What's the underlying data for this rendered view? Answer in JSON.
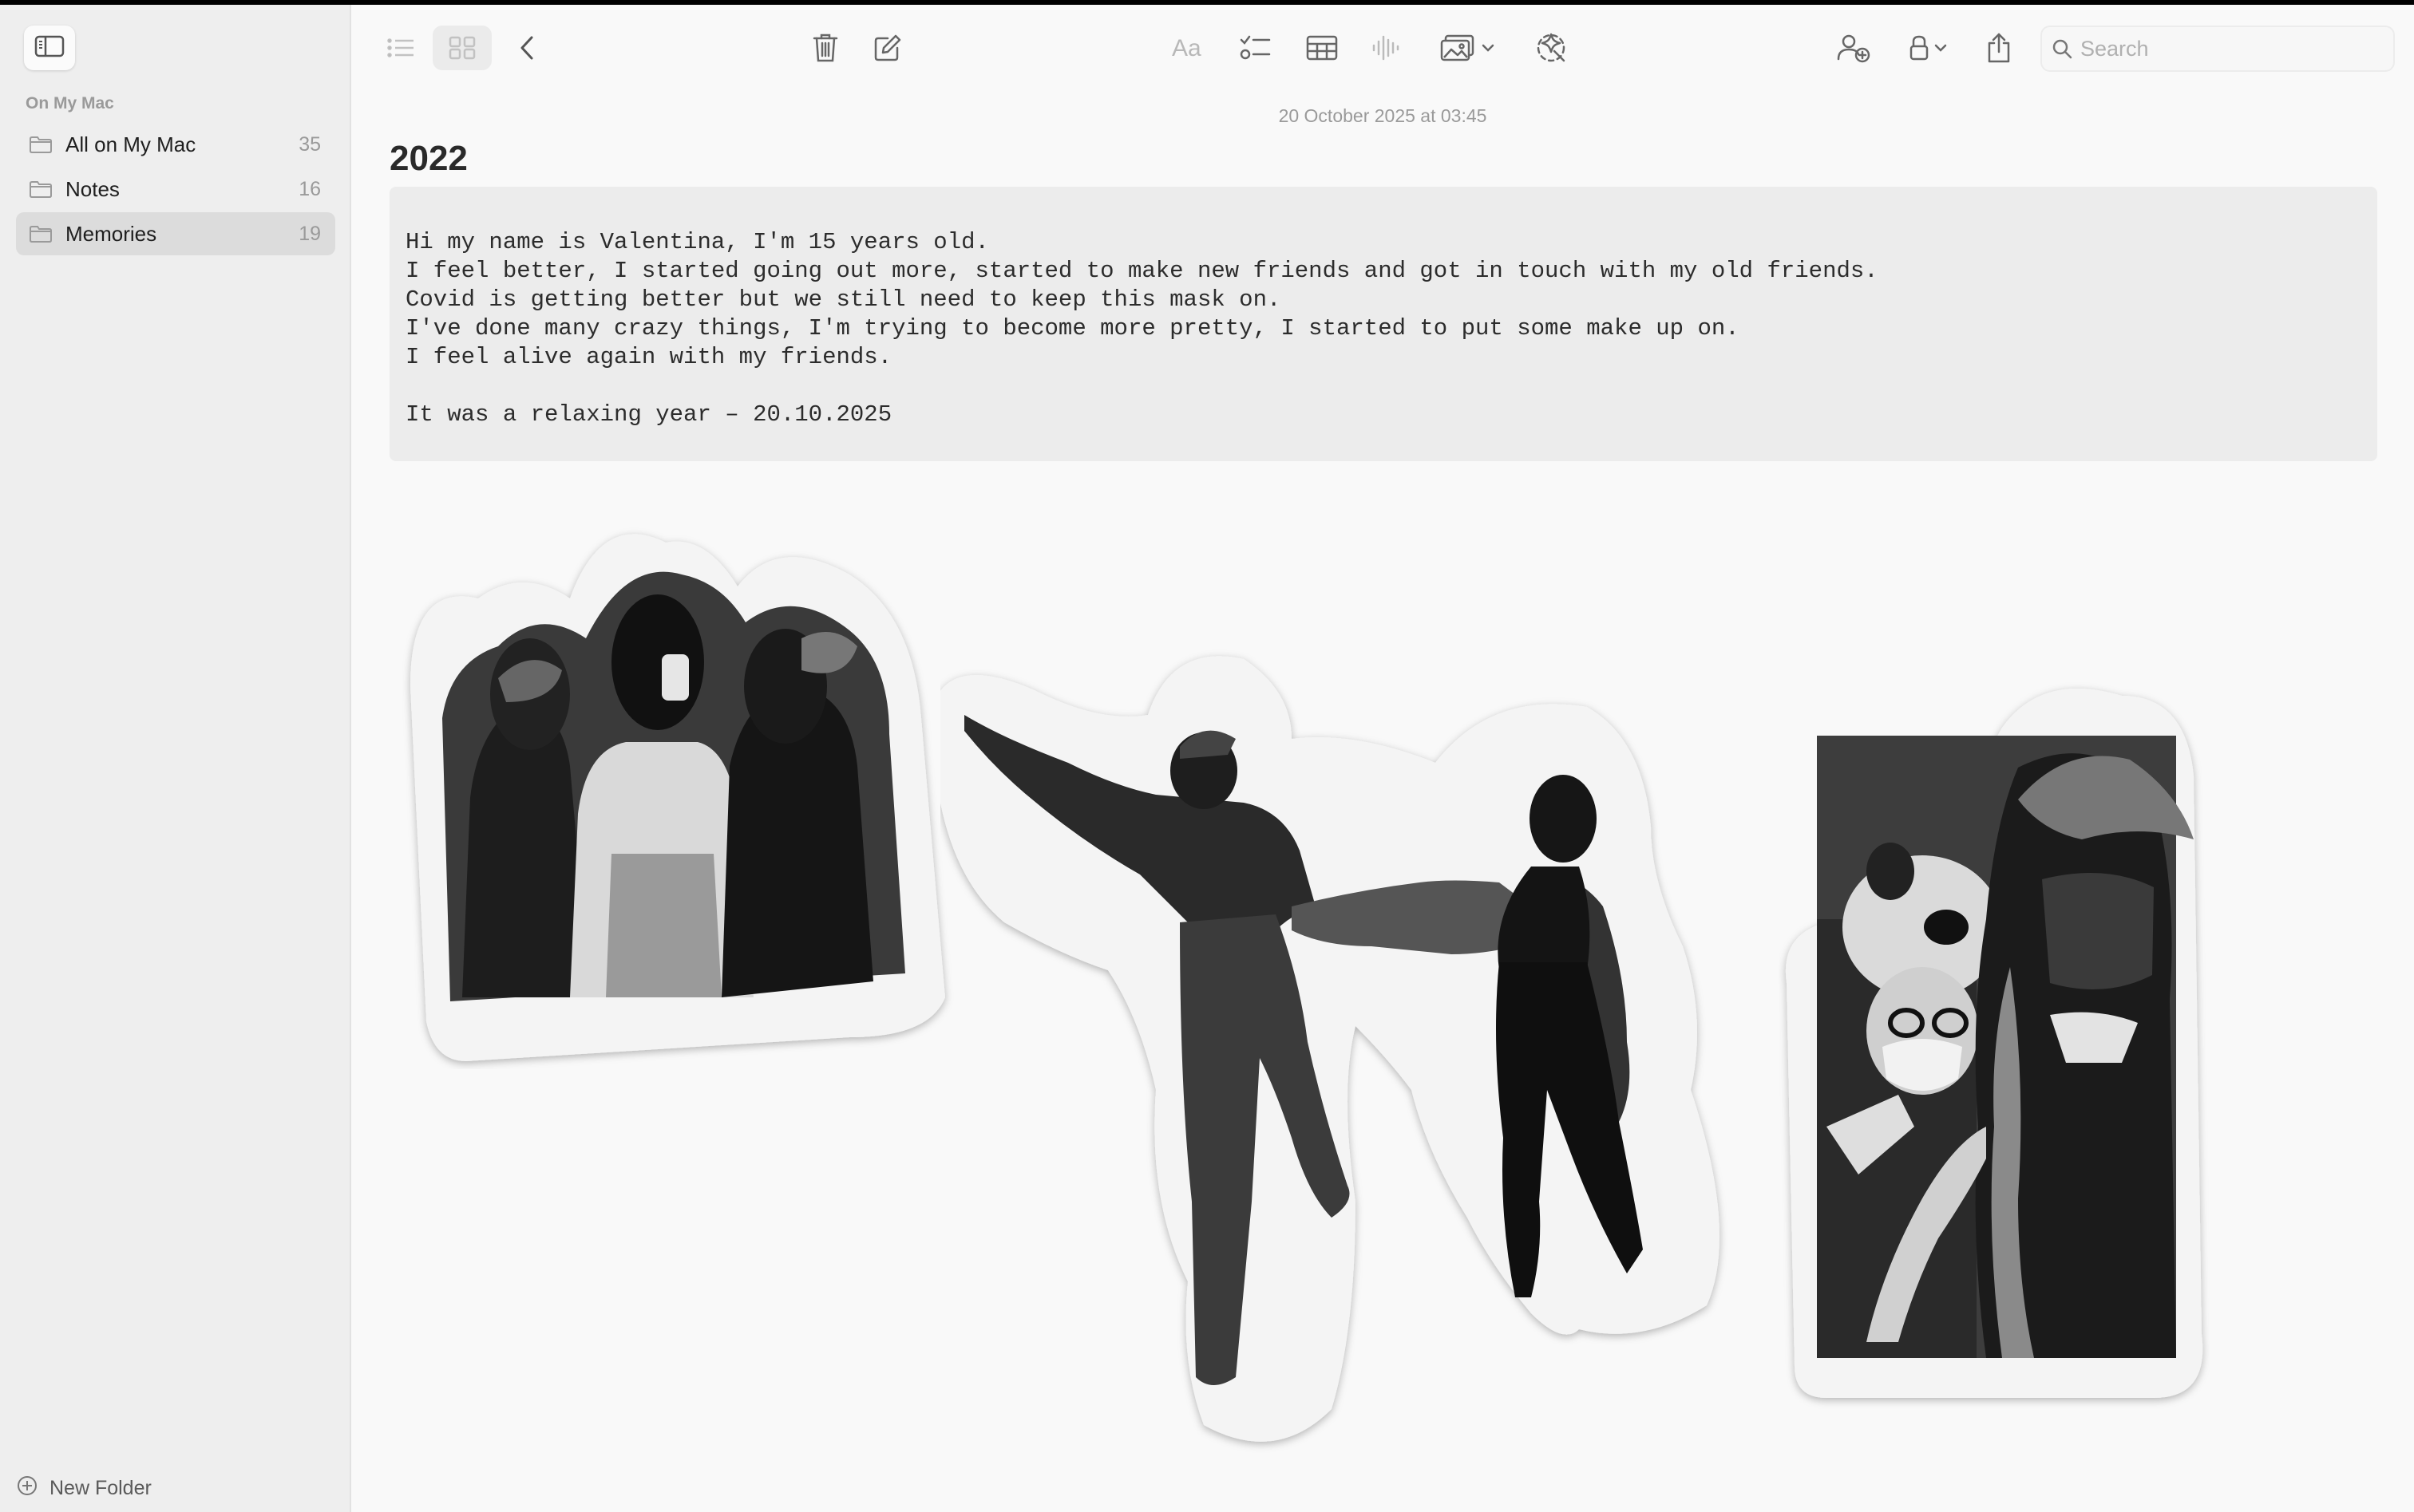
{
  "sidebar": {
    "section_label": "On My Mac",
    "folders": [
      {
        "name": "All on My Mac",
        "count": "35"
      },
      {
        "name": "Notes",
        "count": "16"
      },
      {
        "name": "Memories",
        "count": "19"
      }
    ],
    "selected_folder": "Memories",
    "new_folder_label": "New Folder"
  },
  "toolbar": {
    "icons": [
      "sidebar-toggle-icon",
      "list-view-icon",
      "gallery-view-icon",
      "back-icon",
      "trash-icon",
      "compose-icon",
      "text-format-icon",
      "checklist-icon",
      "table-icon",
      "audio-waveform-icon",
      "media-icon",
      "writing-tools-icon",
      "collaborate-icon",
      "lock-icon",
      "share-icon",
      "search-icon"
    ],
    "search_placeholder": "Search"
  },
  "note": {
    "date": "20 October 2025 at 03:45",
    "title": "2022",
    "body_lines": [
      "Hi my name is Valentina, I'm 15 years old.",
      "I feel better, I started going out more, started to make new friends and got in touch with my old friends.",
      "Covid is getting better but we still need to keep this mask on.",
      "I've done many crazy things, I'm trying to become more pretty, I started to put some make up on.",
      "I feel alive again with my friends.",
      "",
      "It was a relaxing year – 20.10.2025"
    ],
    "images": [
      "three-friends-photo",
      "friends-holding-hands-cutout",
      "selfie-with-masks-photo"
    ]
  },
  "colors": {
    "window_bg": "#f9f9f9",
    "sidebar_bg": "#eeeeee",
    "selected_bg": "#dcdcdc",
    "code_bg": "#ececec",
    "icon_gray": "#6e6e6e"
  }
}
